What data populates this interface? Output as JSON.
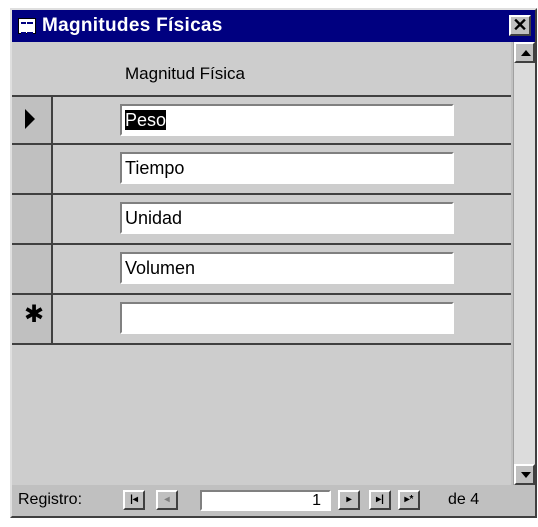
{
  "window": {
    "title": "Magnitudes Físicas",
    "close_label": "✕",
    "icon": "form-icon"
  },
  "form": {
    "column_header": "Magnitud Física",
    "records": [
      {
        "value": "Peso",
        "selector": "current-record",
        "selected": true
      },
      {
        "value": "Tiempo",
        "selector": "none"
      },
      {
        "value": "Unidad",
        "selector": "none"
      },
      {
        "value": "Volumen",
        "selector": "none"
      },
      {
        "value": "",
        "selector": "new-record"
      }
    ]
  },
  "navigation": {
    "label": "Registro:",
    "first_label": "|◂",
    "prev_label": "◂",
    "current_record": "1",
    "next_label": "▸",
    "last_label": "▸|",
    "new_label": "▸*",
    "of_label": "de 4"
  }
}
